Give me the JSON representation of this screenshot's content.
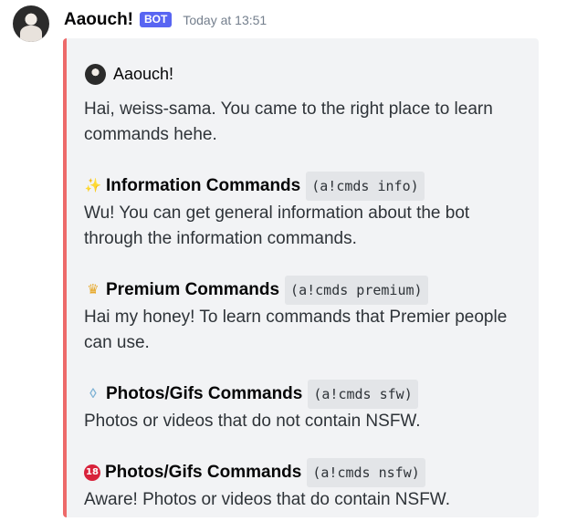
{
  "message": {
    "username": "Aaouch!",
    "bot_tag": "BOT",
    "timestamp": "Today at 13:51"
  },
  "embed": {
    "accent_color": "#ed6a6a",
    "author": "Aaouch!",
    "description": "Hai, weiss-sama. You came to the right place to learn commands hehe.",
    "fields": [
      {
        "icon": "sparkles-icon",
        "title": "Information Commands",
        "command": "(a!cmds info)",
        "value": "Wu! You can get general information about the bot through the information commands."
      },
      {
        "icon": "crown-icon",
        "title": "Premium Commands",
        "command": "(a!cmds premium)",
        "value": "Hai my honey! To learn commands that Premier people can use."
      },
      {
        "icon": "ring-icon",
        "title": "Photos/Gifs Commands",
        "command": "(a!cmds sfw)",
        "value": "Photos or videos that do not contain NSFW."
      },
      {
        "icon": "underage-icon",
        "title": "Photos/Gifs Commands",
        "command": "(a!cmds nsfw)",
        "value": "Aware! Photos or videos that do contain NSFW."
      }
    ]
  }
}
